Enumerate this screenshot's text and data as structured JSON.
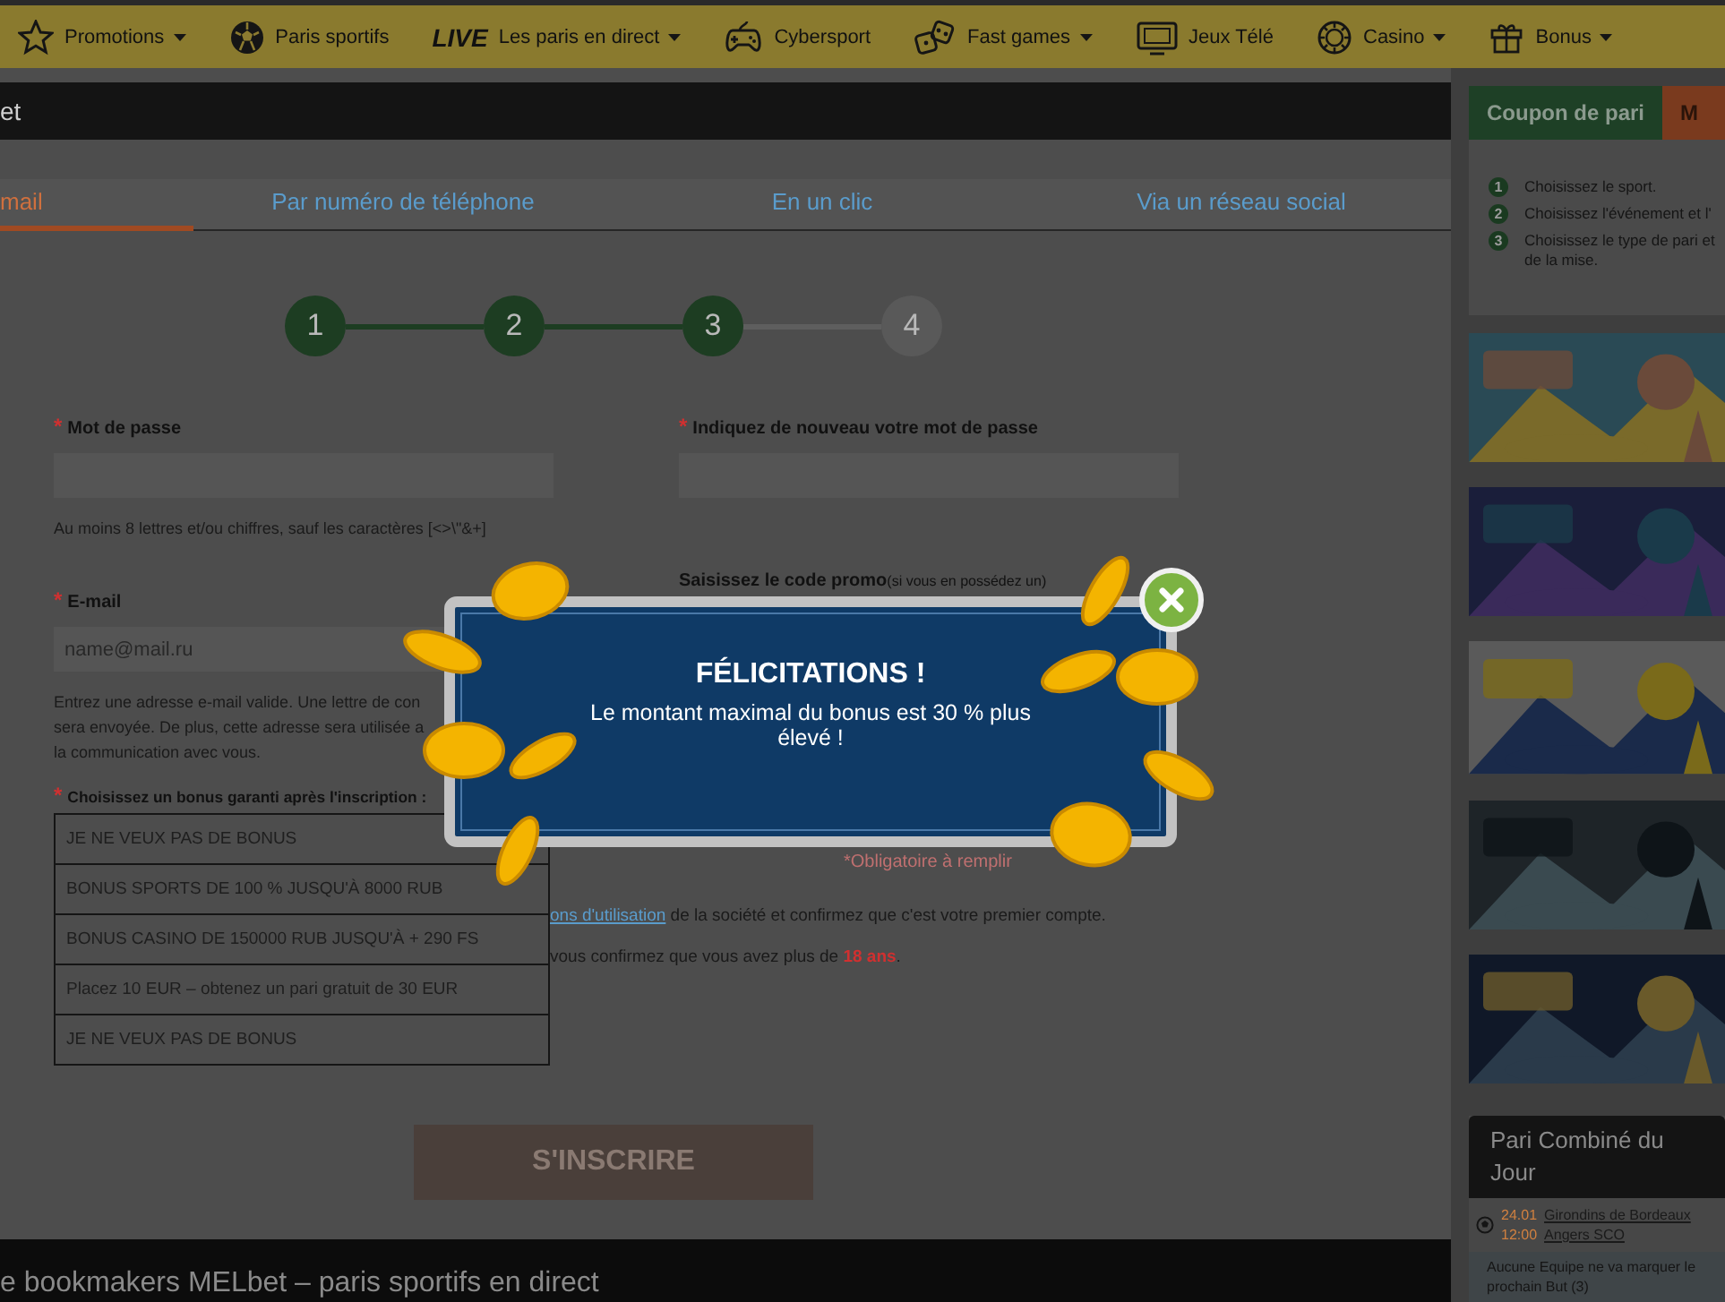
{
  "nav": [
    {
      "kind": "star",
      "label": "Promotions",
      "caret": true
    },
    {
      "kind": "ball",
      "label": "Paris sportifs",
      "caret": false
    },
    {
      "kind": "live",
      "badge": "LIVE",
      "label": "Les paris en direct",
      "caret": true
    },
    {
      "kind": "gamepad",
      "label": "Cybersport",
      "caret": false
    },
    {
      "kind": "dice",
      "label": "Fast games",
      "caret": true
    },
    {
      "kind": "tv",
      "label": "Jeux Télé",
      "caret": false
    },
    {
      "kind": "chip",
      "label": "Casino",
      "caret": true
    },
    {
      "kind": "gift",
      "label": "Bonus",
      "caret": true
    }
  ],
  "header": {
    "title": "et"
  },
  "tabs": [
    {
      "label": "mail",
      "selected": true
    },
    {
      "label": "Par numéro de téléphone",
      "selected": false
    },
    {
      "label": "En un clic",
      "selected": false
    },
    {
      "label": "Via un réseau social",
      "selected": false
    }
  ],
  "steps": [
    {
      "label": "1",
      "done": true
    },
    {
      "label": "2",
      "done": true
    },
    {
      "label": "3",
      "done": true
    },
    {
      "label": "4",
      "done": false
    }
  ],
  "form": {
    "password": {
      "mark": "*",
      "label": "Mot de passe",
      "hint": "Au moins 8 lettres et/ou chiffres, sauf les caractères [<>\\\"&+]"
    },
    "confirm": {
      "mark": "*",
      "label": "Indiquez de nouveau votre mot de passe"
    },
    "email": {
      "mark": "*",
      "label": "E-mail",
      "placeholder": "name@mail.ru",
      "hint_lines": [
        "Entrez une adresse e-mail valide. Une lettre de con",
        "sera envoyée. De plus, cette adresse sera utilisée a",
        "la communication avec vous."
      ]
    },
    "promo": {
      "label": "Saisissez le code promo",
      "note": "(si vous en possédez un)"
    },
    "bonus": {
      "mark": "*",
      "label": "Choisissez un bonus garanti après l'inscription :",
      "options": [
        "JE NE VEUX PAS DE BONUS",
        "BONUS SPORTS DE 100 % JUSQU'À 8000 RUB",
        "BONUS CASINO DE 150000 RUB JUSQU'À + 290 FS",
        "Placez 10 EUR – obtenez un pari gratuit de 30 EUR",
        "JE NE VEUX PAS DE BONUS"
      ]
    },
    "required_note": "*Obligatoire à remplir",
    "terms": [
      {
        "link": "ons d'utilisation",
        "text": " de la société et confirmez que c'est votre premier compte."
      },
      {
        "text": "vous confirmez que vous avez plus de **18 ans**."
      }
    ],
    "submit": {
      "label": "S'INSCRIRE",
      "disabled": true
    }
  },
  "modal": {
    "title": "FÉLICITATIONS !",
    "text": "Le montant maximal du bonus est 30 % plus élevé !"
  },
  "sidebar": {
    "tabs": [
      {
        "label": "Coupon de pari",
        "selected": true
      },
      {
        "label": "M",
        "selected": false
      }
    ],
    "steps": [
      {
        "number": "1",
        "text": "Choisissez le sport."
      },
      {
        "number": "2",
        "text": "Choisissez l'événement et l'"
      },
      {
        "number": "3",
        "text": "Choisissez le type de pari et de la mise."
      }
    ],
    "combo": {
      "title": "Pari Combiné du Jour",
      "date": "24.01",
      "time": "12:00",
      "team_1": "Girondins de Bordeaux",
      "team_2": "Angers SCO",
      "bet": "Aucune Equipe ne va marquer le prochain But (3)"
    }
  },
  "footer": {
    "text": "e bookmakers MELbet – paris sportifs en direct"
  }
}
